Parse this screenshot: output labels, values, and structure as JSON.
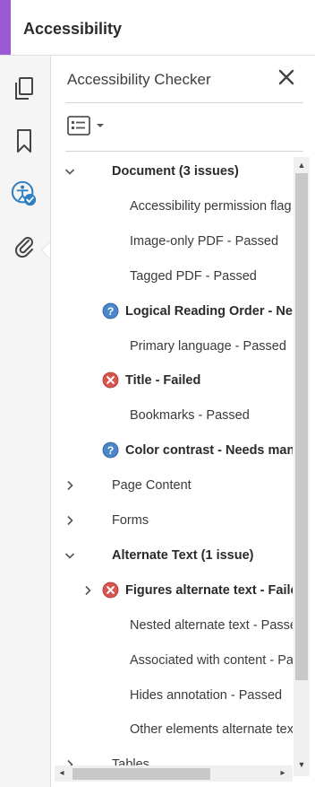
{
  "header": {
    "title": "Accessibility"
  },
  "rail": {
    "icons": [
      "pages-icon",
      "bookmark-icon",
      "accessibility-icon",
      "attachment-icon"
    ],
    "accent_color": "#9b59d6"
  },
  "panel": {
    "title": "Accessibility Checker",
    "close_icon": "close-icon",
    "options_icon": "options-icon"
  },
  "tree": [
    {
      "id": "document",
      "label": "Document (3 issues)",
      "bold": true,
      "expander": "expanded",
      "status": null
    },
    {
      "id": "permission-flag",
      "label": "Accessibility permission flag",
      "bold": false,
      "expander": null,
      "status": null
    },
    {
      "id": "image-only",
      "label": "Image-only PDF - Passed",
      "bold": false,
      "expander": null,
      "status": null
    },
    {
      "id": "tagged-pdf",
      "label": "Tagged PDF - Passed",
      "bold": false,
      "expander": null,
      "status": null
    },
    {
      "id": "reading-order",
      "label": "Logical Reading Order - Needs manual check",
      "bold": true,
      "expander": null,
      "status": "needs-check"
    },
    {
      "id": "primary-language",
      "label": "Primary language - Passed",
      "bold": false,
      "expander": null,
      "status": null
    },
    {
      "id": "title",
      "label": "Title - Failed",
      "bold": true,
      "expander": null,
      "status": "failed"
    },
    {
      "id": "bookmarks",
      "label": "Bookmarks - Passed",
      "bold": false,
      "expander": null,
      "status": null
    },
    {
      "id": "color-contrast",
      "label": "Color contrast - Needs manual check",
      "bold": true,
      "expander": null,
      "status": "needs-check"
    },
    {
      "id": "page-content",
      "label": "Page Content",
      "bold": false,
      "expander": "collapsed",
      "status": null
    },
    {
      "id": "forms",
      "label": "Forms",
      "bold": false,
      "expander": "collapsed",
      "status": null
    },
    {
      "id": "alternate-text",
      "label": "Alternate Text (1 issue)",
      "bold": true,
      "expander": "expanded",
      "status": null
    },
    {
      "id": "figures-alt",
      "label": "Figures alternate text - Failed",
      "bold": true,
      "expander": "collapsed",
      "status": "failed"
    },
    {
      "id": "nested-alt",
      "label": "Nested alternate text - Passed",
      "bold": false,
      "expander": null,
      "status": null
    },
    {
      "id": "associated-content",
      "label": "Associated with content - Passed",
      "bold": false,
      "expander": null,
      "status": null
    },
    {
      "id": "hides-annotation",
      "label": "Hides annotation - Passed",
      "bold": false,
      "expander": null,
      "status": null
    },
    {
      "id": "other-elements",
      "label": "Other elements alternate text - Passed",
      "bold": false,
      "expander": null,
      "status": null
    },
    {
      "id": "tables",
      "label": "Tables",
      "bold": false,
      "expander": "collapsed",
      "status": null
    }
  ],
  "colors": {
    "needs_check": "#4a86c8",
    "failed": "#d9534f"
  }
}
